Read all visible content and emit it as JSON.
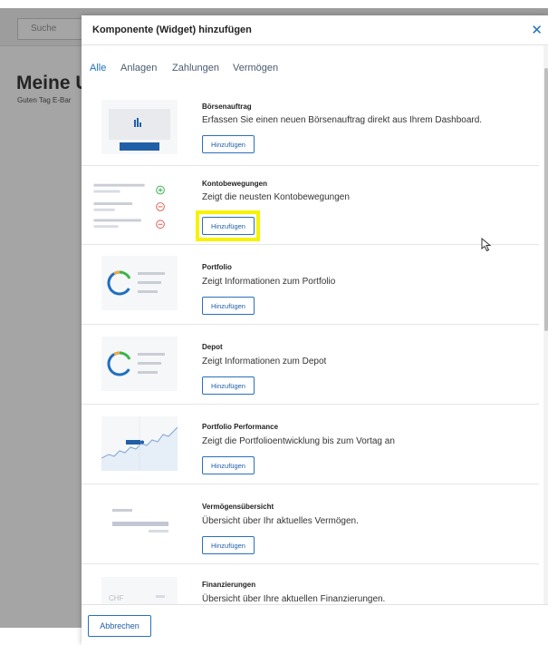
{
  "background": {
    "search_placeholder": "Suche",
    "page_title": "Meine U",
    "greeting": "Guten Tag E-Bar"
  },
  "modal": {
    "title": "Komponente (Widget) hinzufügen",
    "close_icon": "close-icon",
    "tabs": [
      {
        "label": "Alle",
        "active": true
      },
      {
        "label": "Anlagen",
        "active": false
      },
      {
        "label": "Zahlungen",
        "active": false
      },
      {
        "label": "Vermögen",
        "active": false
      }
    ],
    "add_label": "Hinzufügen",
    "widgets": [
      {
        "name": "Börsenauftrag",
        "description": "Erfassen Sie einen neuen Börsenauftrag direkt aus Ihrem Dashboard."
      },
      {
        "name": "Kontobewegungen",
        "description": "Zeigt die neusten Kontobewegungen",
        "highlighted": true
      },
      {
        "name": "Portfolio",
        "description": "Zeigt Informationen zum Portfolio"
      },
      {
        "name": "Depot",
        "description": "Zeigt Informationen zum Depot"
      },
      {
        "name": "Portfolio Performance",
        "description": "Zeigt die Portfolioentwicklung bis zum Vortag an"
      },
      {
        "name": "Vermögensübersicht",
        "description": "Übersicht über Ihr aktuelles Vermögen."
      },
      {
        "name": "Finanzierungen",
        "description": "Übersicht über Ihre aktuellen Finanzierungen.",
        "thumb_text": "CHF"
      }
    ],
    "cancel_label": "Abbrechen"
  },
  "colors": {
    "accent": "#1f6fbf",
    "highlight": "#f6f200",
    "positive": "#3cb44b",
    "negative": "#e05a4f"
  }
}
